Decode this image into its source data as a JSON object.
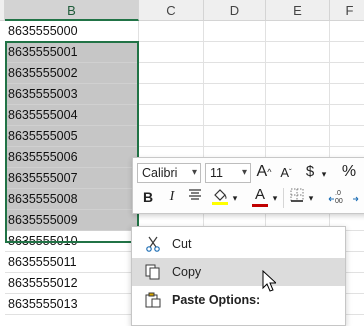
{
  "columns": [
    {
      "label": "B",
      "selected": true
    },
    {
      "label": "C",
      "selected": false
    },
    {
      "label": "D",
      "selected": false
    },
    {
      "label": "E",
      "selected": false
    },
    {
      "label": "F",
      "selected": false
    }
  ],
  "rows": [
    "8635555000",
    "8635555001",
    "8635555002",
    "8635555003",
    "8635555004",
    "8635555005",
    "8635555006",
    "8635555007",
    "8635555008",
    "8635555009",
    "8635555010",
    "8635555011",
    "8635555012",
    "8635555013"
  ],
  "mini_toolbar": {
    "font_name": "Calibri",
    "font_size": "11",
    "grow_font": "A",
    "shrink_font": "A",
    "currency": "$",
    "percent": "%",
    "bold": "B",
    "italic": "I",
    "font_color": "A",
    "fill_color_hex": "#ffff00",
    "font_color_hex": "#c00000"
  },
  "context_menu": {
    "items": [
      {
        "label": "Cut",
        "icon": "scissors-icon"
      },
      {
        "label": "Copy",
        "icon": "copy-icon",
        "hover": true
      },
      {
        "label": "Paste Options:",
        "icon": "paste-icon"
      }
    ]
  },
  "colors": {
    "accent": "#217346",
    "selection_shade": "#c6c6c6"
  }
}
